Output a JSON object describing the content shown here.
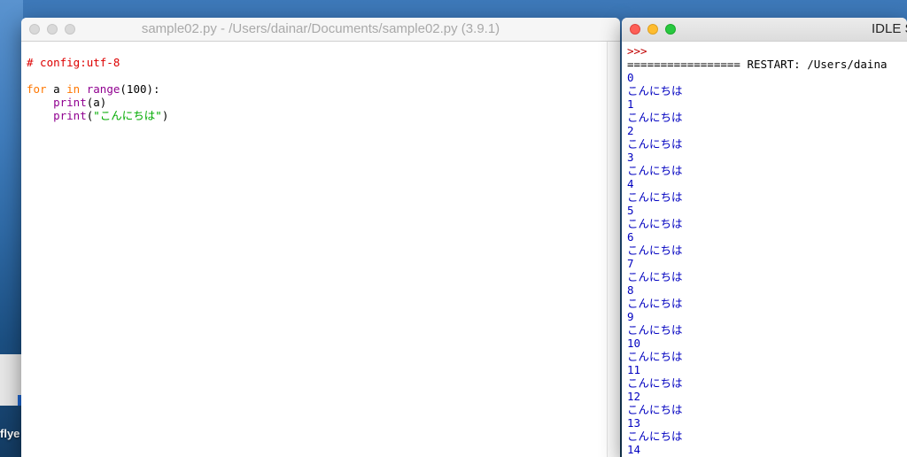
{
  "desktop": {
    "label": "flye"
  },
  "editor": {
    "title": "sample02.py - /Users/dainar/Documents/sample02.py (3.9.1)",
    "code": {
      "comment": "# config:utf-8",
      "line_for": {
        "kw_for": "for",
        "var": " a ",
        "kw_in": "in",
        "space": " ",
        "builtin_range": "range",
        "args": "(100):"
      },
      "line_print_a": {
        "indent": "    ",
        "builtin_print": "print",
        "args": "(a)"
      },
      "line_print_str": {
        "indent": "    ",
        "builtin_print": "print",
        "paren_open": "(",
        "string": "\"こんにちは\"",
        "paren_close": ")"
      }
    }
  },
  "shell": {
    "title": "IDLE S",
    "prompt": ">>>",
    "restart": "================= RESTART: /Users/daina",
    "output": [
      "0",
      "こんにちは",
      "1",
      "こんにちは",
      "2",
      "こんにちは",
      "3",
      "こんにちは",
      "4",
      "こんにちは",
      "5",
      "こんにちは",
      "6",
      "こんにちは",
      "7",
      "こんにちは",
      "8",
      "こんにちは",
      "9",
      "こんにちは",
      "10",
      "こんにちは",
      "11",
      "こんにちは",
      "12",
      "こんにちは",
      "13",
      "こんにちは",
      "14"
    ]
  },
  "colors": {
    "comment": "#dd0000",
    "keyword": "#ff7700",
    "builtin": "#900090",
    "string": "#00aa00",
    "output": "#0000c0",
    "prompt": "#c00000"
  }
}
